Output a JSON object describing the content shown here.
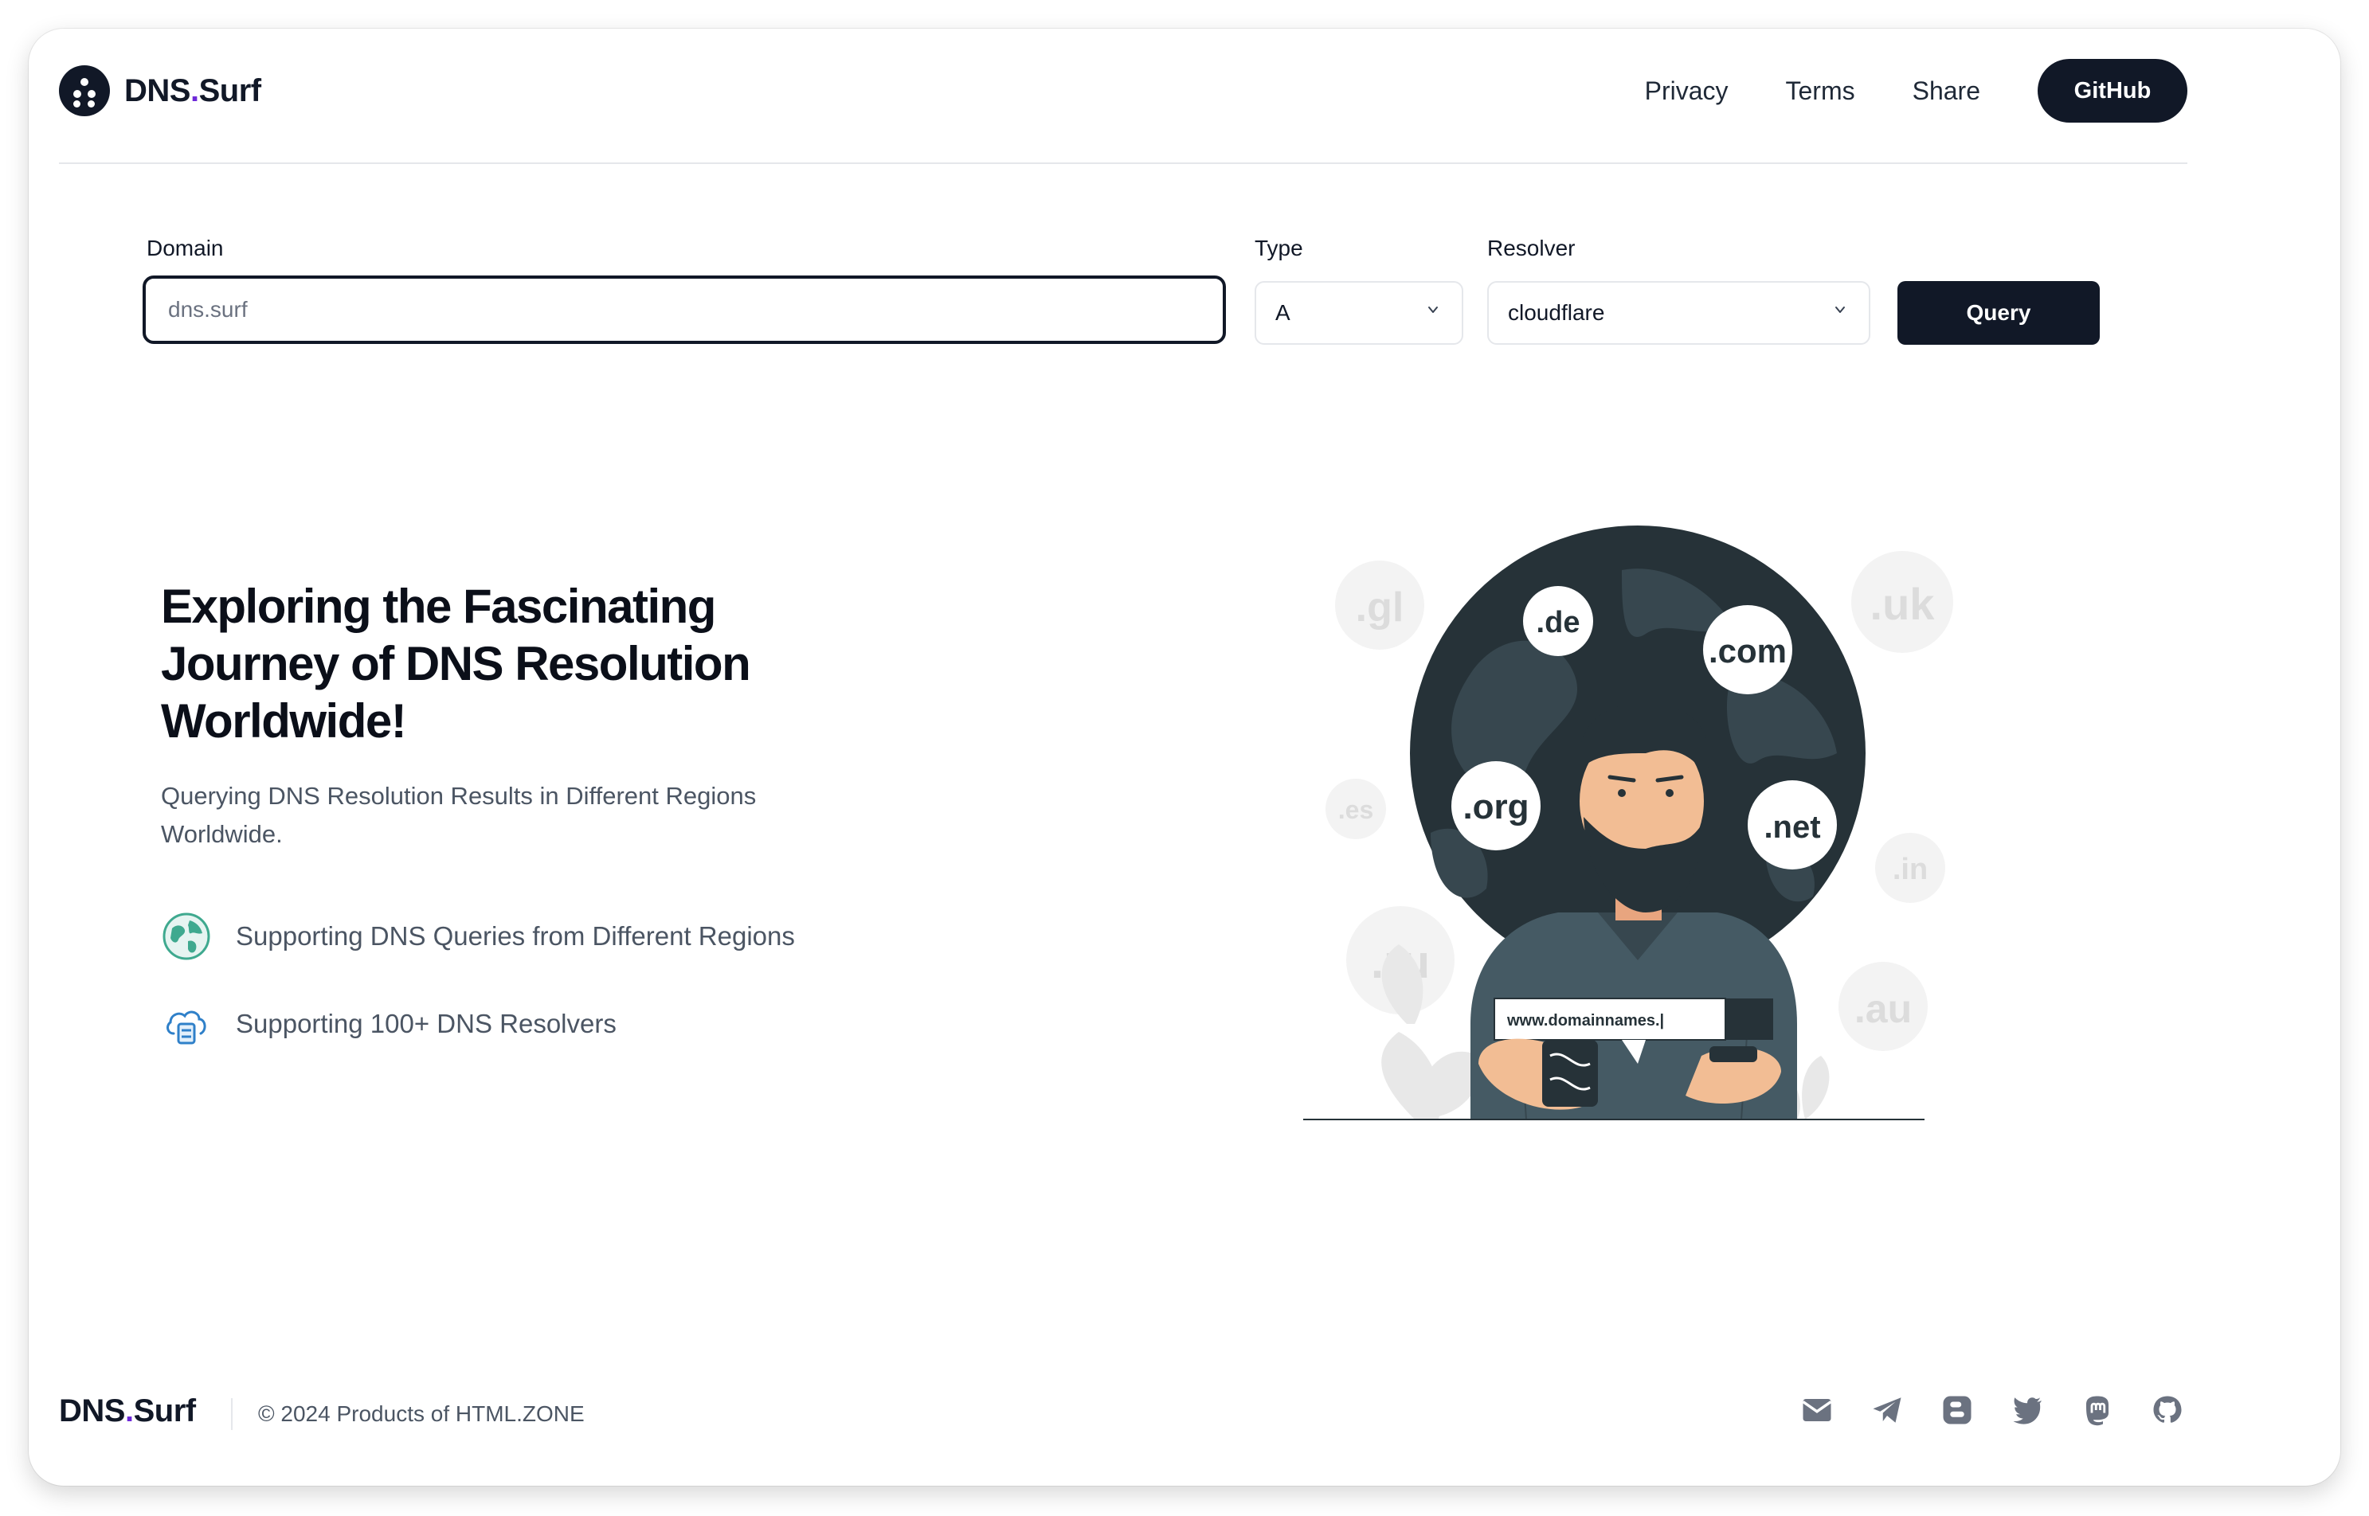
{
  "header": {
    "brand": {
      "prefix": "DNS",
      "dot": ".",
      "suffix": "Surf"
    },
    "nav": {
      "privacy": "Privacy",
      "terms": "Terms",
      "share": "Share",
      "github": "GitHub"
    }
  },
  "form": {
    "domain_label": "Domain",
    "domain_placeholder": "dns.surf",
    "domain_value": "",
    "type_label": "Type",
    "type_value": "A",
    "resolver_label": "Resolver",
    "resolver_value": "cloudflare",
    "query_label": "Query"
  },
  "hero": {
    "title": "Exploring the Fascinating Journey of DNS Resolution Worldwide!",
    "subtitle": "Querying DNS Resolution Results in Different Regions Worldwide.",
    "features": [
      {
        "icon": "globe-icon",
        "text": "Supporting DNS Queries from Different Regions"
      },
      {
        "icon": "cloud-server-icon",
        "text": "Supporting 100+ DNS Resolvers"
      }
    ]
  },
  "illustration": {
    "bubbles": [
      ".de",
      ".com",
      ".org",
      ".net"
    ],
    "faded": [
      ".gl",
      ".uk",
      ".es",
      ".in",
      ".ru",
      ".au"
    ],
    "search_text": "www.domainnames.|"
  },
  "footer": {
    "brand": {
      "prefix": "DNS",
      "dot": ".",
      "suffix": "Surf"
    },
    "copyright": "© 2024 Products of HTML.ZONE",
    "socials": [
      "mail-icon",
      "telegram-icon",
      "blogger-icon",
      "twitter-icon",
      "mastodon-icon",
      "github-icon"
    ]
  },
  "colors": {
    "primary": "#111827",
    "accent": "#6d28d9",
    "muted": "#4b5563",
    "border": "#e5e7eb",
    "globe": "#263238"
  }
}
